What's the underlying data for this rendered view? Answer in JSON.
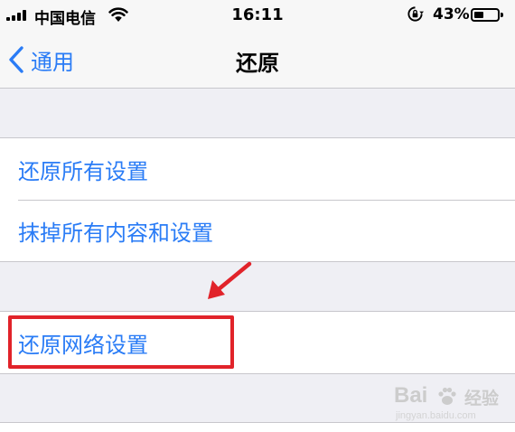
{
  "status_bar": {
    "carrier": "中国电信",
    "time": "16:11",
    "battery_percent": "43%",
    "battery_level": 0.43
  },
  "nav": {
    "back_label": "通用",
    "title": "还原"
  },
  "groups": [
    {
      "items": [
        {
          "label": "还原所有设置"
        },
        {
          "label": "抹掉所有内容和设置"
        }
      ]
    },
    {
      "items": [
        {
          "label": "还原网络设置"
        }
      ]
    }
  ],
  "annotation": {
    "color": "#e1232a"
  },
  "watermark": {
    "brand": "Bai",
    "service": "经验",
    "domain": "jingyan.baidu.com"
  },
  "colors": {
    "accent": "#2a7cf6",
    "background": "#efeff4"
  }
}
